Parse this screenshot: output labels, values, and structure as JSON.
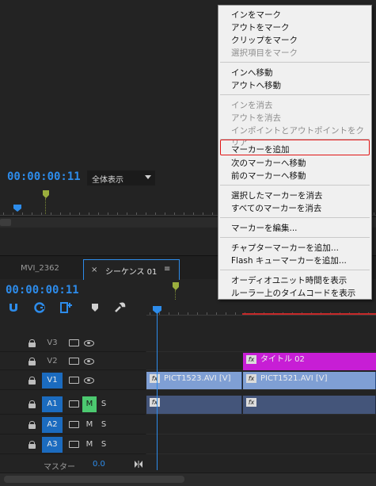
{
  "source_monitor": {
    "timecode": "00:00:00:11",
    "zoom_value": "全体表示"
  },
  "tabs": [
    {
      "label": "MVI_2362"
    },
    {
      "label": "シーケンス 01",
      "close": "×",
      "menu": "≡"
    }
  ],
  "timeline": {
    "timecode": "00:00:00:11",
    "tracks": [
      {
        "name": "V3"
      },
      {
        "name": "V2"
      },
      {
        "name": "V1"
      },
      {
        "name": "A1",
        "m": "M",
        "s": "S"
      },
      {
        "name": "A2",
        "m": "M",
        "s": "S"
      },
      {
        "name": "A3",
        "m": "M",
        "s": "S"
      }
    ],
    "clips": {
      "title": "タイトル 02",
      "v1_a": "PICT1523.AVI [V]",
      "v1_b": "PICT1521.AVI [V]",
      "fx": "fx"
    },
    "master": {
      "label": "マスター",
      "value": "0.0"
    }
  },
  "context_menu": {
    "items": [
      {
        "label": "インをマーク",
        "enabled": true
      },
      {
        "label": "アウトをマーク",
        "enabled": true
      },
      {
        "label": "クリップをマーク",
        "enabled": true
      },
      {
        "label": "選択項目をマーク",
        "enabled": false
      },
      {
        "label": "インへ移動",
        "enabled": true
      },
      {
        "label": "アウトへ移動",
        "enabled": true
      },
      {
        "label": "インを消去",
        "enabled": false
      },
      {
        "label": "アウトを消去",
        "enabled": false
      },
      {
        "label": "インポイントとアウトポイントをクリア",
        "enabled": false
      },
      {
        "label": "マーカーを追加",
        "enabled": true,
        "highlighted": true
      },
      {
        "label": "次のマーカーへ移動",
        "enabled": true
      },
      {
        "label": "前のマーカーへ移動",
        "enabled": true
      },
      {
        "label": "選択したマーカーを消去",
        "enabled": true
      },
      {
        "label": "すべてのマーカーを消去",
        "enabled": true
      },
      {
        "label": "マーカーを編集...",
        "enabled": true
      },
      {
        "label": "チャプターマーカーを追加...",
        "enabled": true
      },
      {
        "label": "Flash キューマーカーを追加...",
        "enabled": true
      },
      {
        "label": "オーディオユニット時間を表示",
        "enabled": true
      },
      {
        "label": "ルーラー上のタイムコードを表示",
        "enabled": true
      }
    ]
  },
  "colors": {
    "accent_blue": "#2d8ceb",
    "marker_green": "#9aae3d",
    "title_clip": "#c71ed5",
    "video_clip": "#7f9fd4",
    "audio_clip": "#44557a",
    "highlight_red": "#e01515"
  },
  "icons": [
    "snap-icon",
    "linked-selection-icon",
    "add-edit-icon",
    "marker-icon",
    "wrench-icon",
    "lock-icon",
    "sync-icon",
    "eye-icon",
    "fx-badge-icon",
    "end-icon"
  ]
}
